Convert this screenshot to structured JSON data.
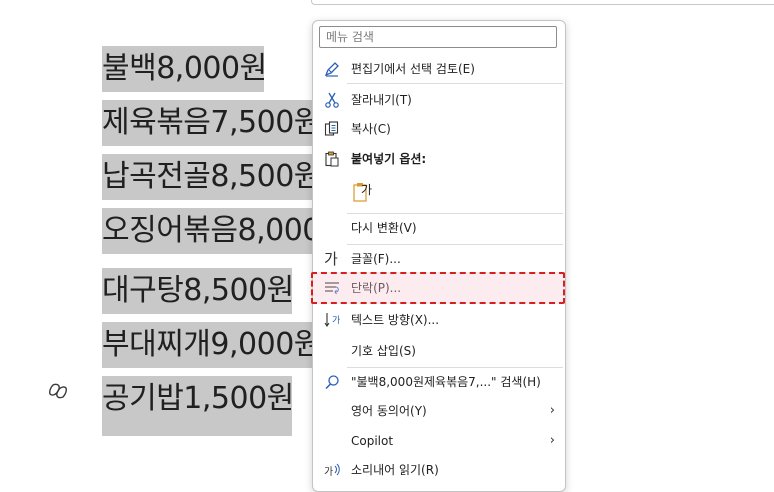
{
  "document": {
    "lines": [
      "불백8,000원",
      "제육볶음7,500원",
      "납곡전골8,500원",
      "오징어볶음8,000원",
      "대구탕8,500원",
      "부대찌개9,000원",
      "공기밥1,500원"
    ]
  },
  "context_menu": {
    "search_placeholder": "메뉴 검색",
    "items": {
      "editor_review": "편집기에서 선택 검토(E)",
      "cut": "잘라내기(T)",
      "copy": "복사(C)",
      "paste_options": "붙여넣기 옵션:",
      "convert_again": "다시 변환(V)",
      "font_glyph": "가",
      "font": "글꼴(F)...",
      "paragraph": "단락(P)...",
      "text_direction": "텍스트 방향(X)...",
      "insert_symbol": "기호 삽입(S)",
      "search_selection": "\"불백8,000원제육볶음7,...\" 검색(H)",
      "synonyms": "영어 동의어(Y)",
      "copilot": "Copilot",
      "read_aloud": "소리내어 읽기(R)"
    },
    "paste_glyph": "가",
    "submenu_chevron": "›"
  },
  "colors": {
    "selection": "#c8c8c8",
    "highlight_border": "#d61f1f",
    "accent_blue": "#2a5fb8"
  },
  "icons": {
    "editor": "pen-icon",
    "cut": "scissors-icon",
    "copy": "copy-icon",
    "paste": "clipboard-icon",
    "font": "font-icon",
    "paragraph": "paragraph-icon",
    "text_direction": "text-direction-icon",
    "search": "search-icon",
    "read_aloud": "read-aloud-icon"
  }
}
